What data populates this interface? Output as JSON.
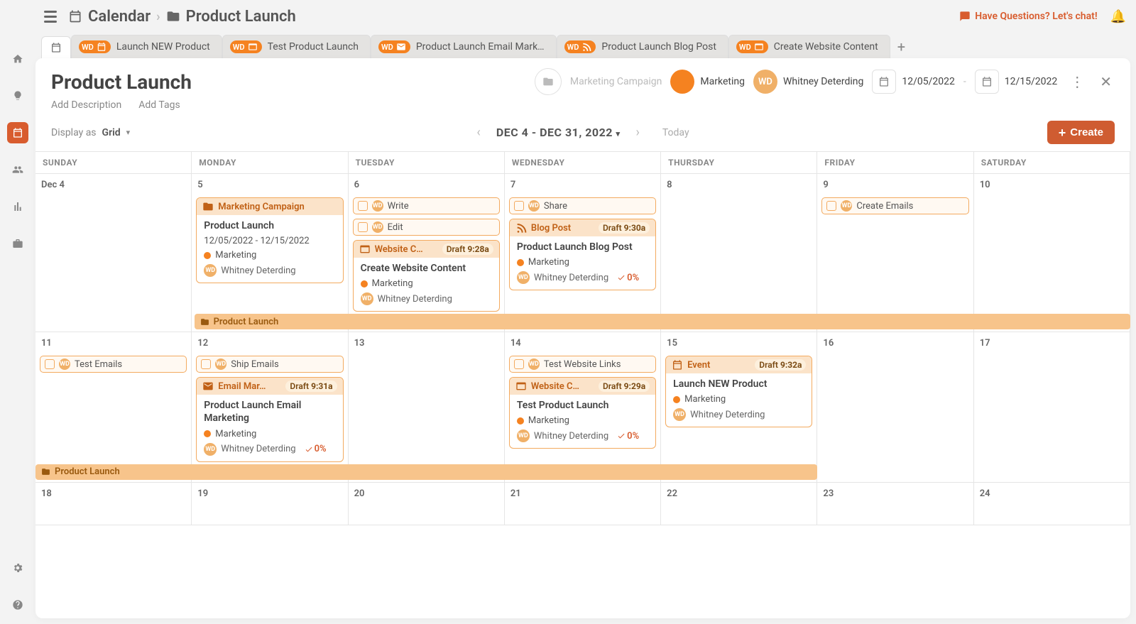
{
  "breadcrumb": {
    "root": "Calendar",
    "leaf": "Product Launch"
  },
  "chat_link": "Have Questions? Let's chat!",
  "tabs": [
    {
      "label": "Launch NEW Product",
      "icon": "calendar"
    },
    {
      "label": "Test Product Launch",
      "icon": "window"
    },
    {
      "label": "Product Launch Email Mark…",
      "icon": "mail"
    },
    {
      "label": "Product Launch Blog Post",
      "icon": "rss"
    },
    {
      "label": "Create Website Content",
      "icon": "window"
    }
  ],
  "project": {
    "title": "Product Launch",
    "add_description": "Add Description",
    "add_tags": "Add Tags",
    "campaign": "Marketing Campaign",
    "tag": "Marketing",
    "owner": "Whitney Deterding",
    "owner_initials": "WD",
    "start": "12/05/2022",
    "end": "12/15/2022",
    "date_sep": "-"
  },
  "toolbar": {
    "display_as": "Display as",
    "mode": "Grid",
    "range": "DEC 4 - DEC 31, 2022",
    "today": "Today",
    "create": "Create"
  },
  "day_headers": [
    "SUNDAY",
    "MONDAY",
    "TUESDAY",
    "WEDNESDAY",
    "THURSDAY",
    "FRIDAY",
    "SATURDAY"
  ],
  "week1": {
    "days": [
      "Dec 4",
      "5",
      "6",
      "7",
      "8",
      "9",
      "10"
    ],
    "mon_card_header": "Marketing Campaign",
    "mon_card_title": "Product Launch",
    "mon_card_dates": "12/05/2022 - 12/15/2022",
    "mon_card_tag": "Marketing",
    "mon_card_owner": "Whitney Deterding",
    "tue_mini1": "Write",
    "tue_mini2": "Edit",
    "tue_card_header": "Website C…",
    "tue_card_status": "Draft",
    "tue_card_time": "9:28a",
    "tue_card_title": "Create Website Content",
    "tue_card_tag": "Marketing",
    "tue_card_owner": "Whitney Deterding",
    "wed_mini": "Share",
    "wed_card_header": "Blog Post",
    "wed_card_status": "Draft",
    "wed_card_time": "9:30a",
    "wed_card_title": "Product Launch Blog Post",
    "wed_card_tag": "Marketing",
    "wed_card_owner": "Whitney Deterding",
    "wed_card_pct": "0%",
    "fri_mini": "Create Emails",
    "spanbar": "Product Launch"
  },
  "week2": {
    "days": [
      "11",
      "12",
      "13",
      "14",
      "15",
      "16",
      "17"
    ],
    "sun_mini": "Test Emails",
    "mon_mini": "Ship Emails",
    "mon_card_header": "Email Mar…",
    "mon_card_status": "Draft",
    "mon_card_time": "9:31a",
    "mon_card_title": "Product Launch Email Marketing",
    "mon_card_tag": "Marketing",
    "mon_card_owner": "Whitney Deterding",
    "mon_card_pct": "0%",
    "wed_mini": "Test Website Links",
    "wed_card_header": "Website C…",
    "wed_card_status": "Draft",
    "wed_card_time": "9:29a",
    "wed_card_title": "Test Product Launch",
    "wed_card_tag": "Marketing",
    "wed_card_owner": "Whitney Deterding",
    "wed_card_pct": "0%",
    "thu_card_header": "Event",
    "thu_card_status": "Draft",
    "thu_card_time": "9:32a",
    "thu_card_title": "Launch NEW Product",
    "thu_card_tag": "Marketing",
    "thu_card_owner": "Whitney Deterding",
    "spanbar": "Product Launch"
  },
  "week3": {
    "days": [
      "18",
      "19",
      "20",
      "21",
      "22",
      "23",
      "24"
    ]
  }
}
